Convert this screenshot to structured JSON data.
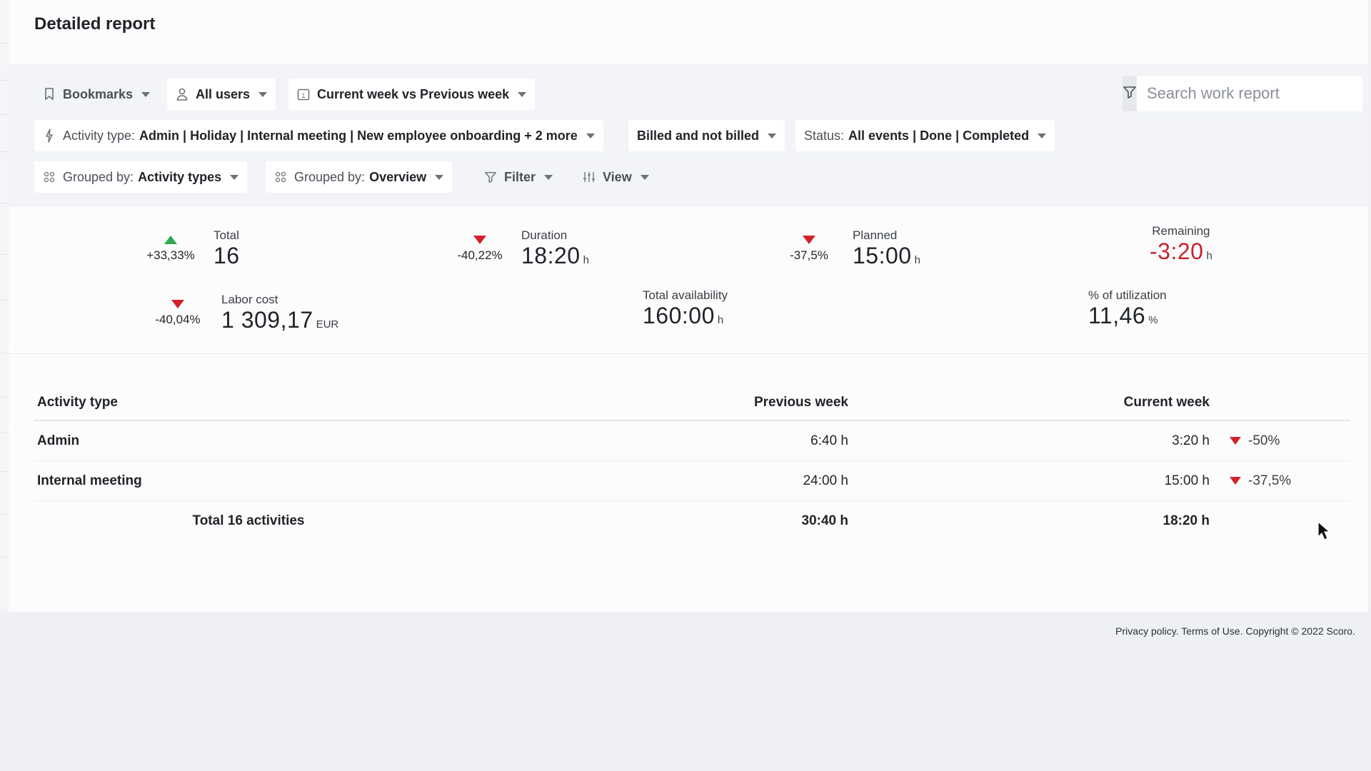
{
  "page": {
    "title": "Detailed report"
  },
  "toolbar": {
    "bookmarks": "Bookmarks",
    "users": "All users",
    "period": "Current week vs Previous week",
    "activity_type_label": "Activity type:",
    "activity_type_value": "Admin | Holiday | Internal meeting | New employee onboarding + 2 more",
    "billing": "Billed and not billed",
    "status_label": "Status:",
    "status_value": "All events | Done | Completed",
    "group1_label": "Grouped by:",
    "group1_value": "Activity types",
    "group2_label": "Grouped by:",
    "group2_value": "Overview",
    "filter": "Filter",
    "view": "View",
    "search_placeholder": "Search work report"
  },
  "kpis": {
    "total": {
      "label": "Total",
      "value": "16",
      "delta": "+33,33%",
      "trend": "up"
    },
    "duration": {
      "label": "Duration",
      "value": "18:20",
      "unit": "h",
      "delta": "-40,22%",
      "trend": "down"
    },
    "planned": {
      "label": "Planned",
      "value": "15:00",
      "unit": "h",
      "delta": "-37,5%",
      "trend": "down"
    },
    "remaining": {
      "label": "Remaining",
      "value": "-3:20",
      "unit": "h",
      "color": "#c8232b"
    },
    "labor_cost": {
      "label": "Labor cost",
      "value": "1 309,17",
      "unit": "EUR",
      "delta": "-40,04%",
      "trend": "down"
    },
    "availability": {
      "label": "Total availability",
      "value": "160:00",
      "unit": "h"
    },
    "utilization": {
      "label": "% of utilization",
      "value": "11,46",
      "unit": "%"
    }
  },
  "table": {
    "headers": {
      "name": "Activity type",
      "prev": "Previous week",
      "cur": "Current week"
    },
    "rows": [
      {
        "name": "Admin",
        "prev": "6:40 h",
        "cur": "3:20 h",
        "delta": "-50%"
      },
      {
        "name": "Internal meeting",
        "prev": "24:00 h",
        "cur": "15:00 h",
        "delta": "-37,5%"
      }
    ],
    "total": {
      "label": "Total 16 activities",
      "prev": "30:40 h",
      "cur": "18:20 h"
    }
  },
  "footer": {
    "text": "Privacy policy. Terms of Use. Copyright © 2022 Scoro."
  },
  "colors": {
    "accent_red": "#c8232b",
    "trend_up": "#2fa84f",
    "trend_down": "#d4202a"
  }
}
